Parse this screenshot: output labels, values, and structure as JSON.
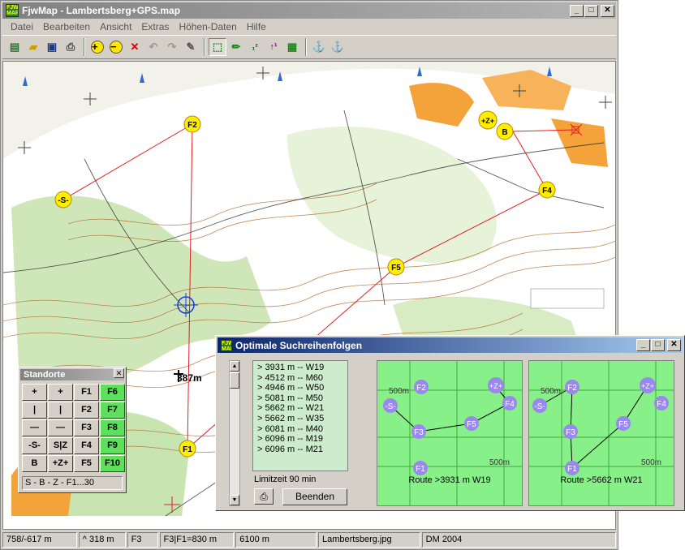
{
  "window": {
    "title": "FjwMap - Lambertsberg+GPS.map",
    "icon_text": "FJW MAP"
  },
  "menu": [
    "Datei",
    "Bearbeiten",
    "Ansicht",
    "Extras",
    "Höhen-Daten",
    "Hilfe"
  ],
  "toolbar": {
    "icons": [
      "new-file-icon",
      "open-folder-icon",
      "save-disk-icon",
      "print-icon",
      "zoom-in-icon",
      "zoom-out-icon",
      "delete-icon",
      "undo-icon",
      "redo-icon",
      "pencil-ruler-icon",
      "route-icon",
      "edit-pen-icon",
      "sort-numbers-icon",
      "sort-up-icon",
      "grid-points-icon",
      "anchor-left-icon",
      "anchor-right-icon"
    ],
    "glyphs": [
      "▤",
      "📂",
      "💾",
      "🖶",
      "+",
      "−",
      "✕",
      "↶",
      "↷",
      "✎",
      "⬚",
      "✏",
      "¹₂",
      "↑₁",
      "▦",
      "⚓",
      "⚓"
    ]
  },
  "map": {
    "controls": [
      {
        "label": "-S-"
      },
      {
        "label": "F2"
      },
      {
        "label": "F5"
      },
      {
        "label": "F4"
      },
      {
        "label": "B"
      },
      {
        "label": "+Z+"
      },
      {
        "label": "F1"
      }
    ],
    "distance_label": "387m"
  },
  "status": [
    "758/-617 m",
    "^ 318 m",
    "F3",
    "F3|F1=830 m",
    "6100 m",
    "Lambertsberg.jpg",
    "DM 2004"
  ],
  "dialog": {
    "title": "Optimale Suchreihenfolgen",
    "results": [
      ">   3931 m   -- W19",
      ">   4512 m   -- M60",
      ">   4946 m   -- W50",
      ">   5081 m   -- M50",
      ">   5662 m   -- W21",
      ">   5662 m   -- W35",
      ">   6081 m   -- M40",
      ">   6096 m   -- M19",
      ">   6096 m   -- M21"
    ],
    "limit_label": "Limitzeit 90 min",
    "end_button": "Beenden",
    "grid_label": "500m",
    "route1": {
      "label": "Route >3931 m  W19",
      "nodes": [
        "F2",
        "+Z+",
        "-S-",
        "F4",
        "F3",
        "F5",
        "F1"
      ]
    },
    "route2": {
      "label": "Route >5662 m  W21",
      "nodes": [
        "F2",
        "+Z+",
        "-S-",
        "F4",
        "F3",
        "F5",
        "F1"
      ]
    }
  },
  "palette": {
    "title": "Standorte",
    "cells": [
      "+",
      "+",
      "F1",
      "F6",
      "|",
      "|",
      "F2",
      "F7",
      "—",
      "—",
      "F3",
      "F8",
      "-S-",
      "S|Z",
      "F4",
      "F9",
      "B",
      "+Z+",
      "F5",
      "F10"
    ],
    "footer": "S - B - Z - F1...30"
  },
  "colors": {
    "route_green": "#88f088",
    "control_yellow": "#ffee00",
    "route_node": "#9a88ee"
  }
}
